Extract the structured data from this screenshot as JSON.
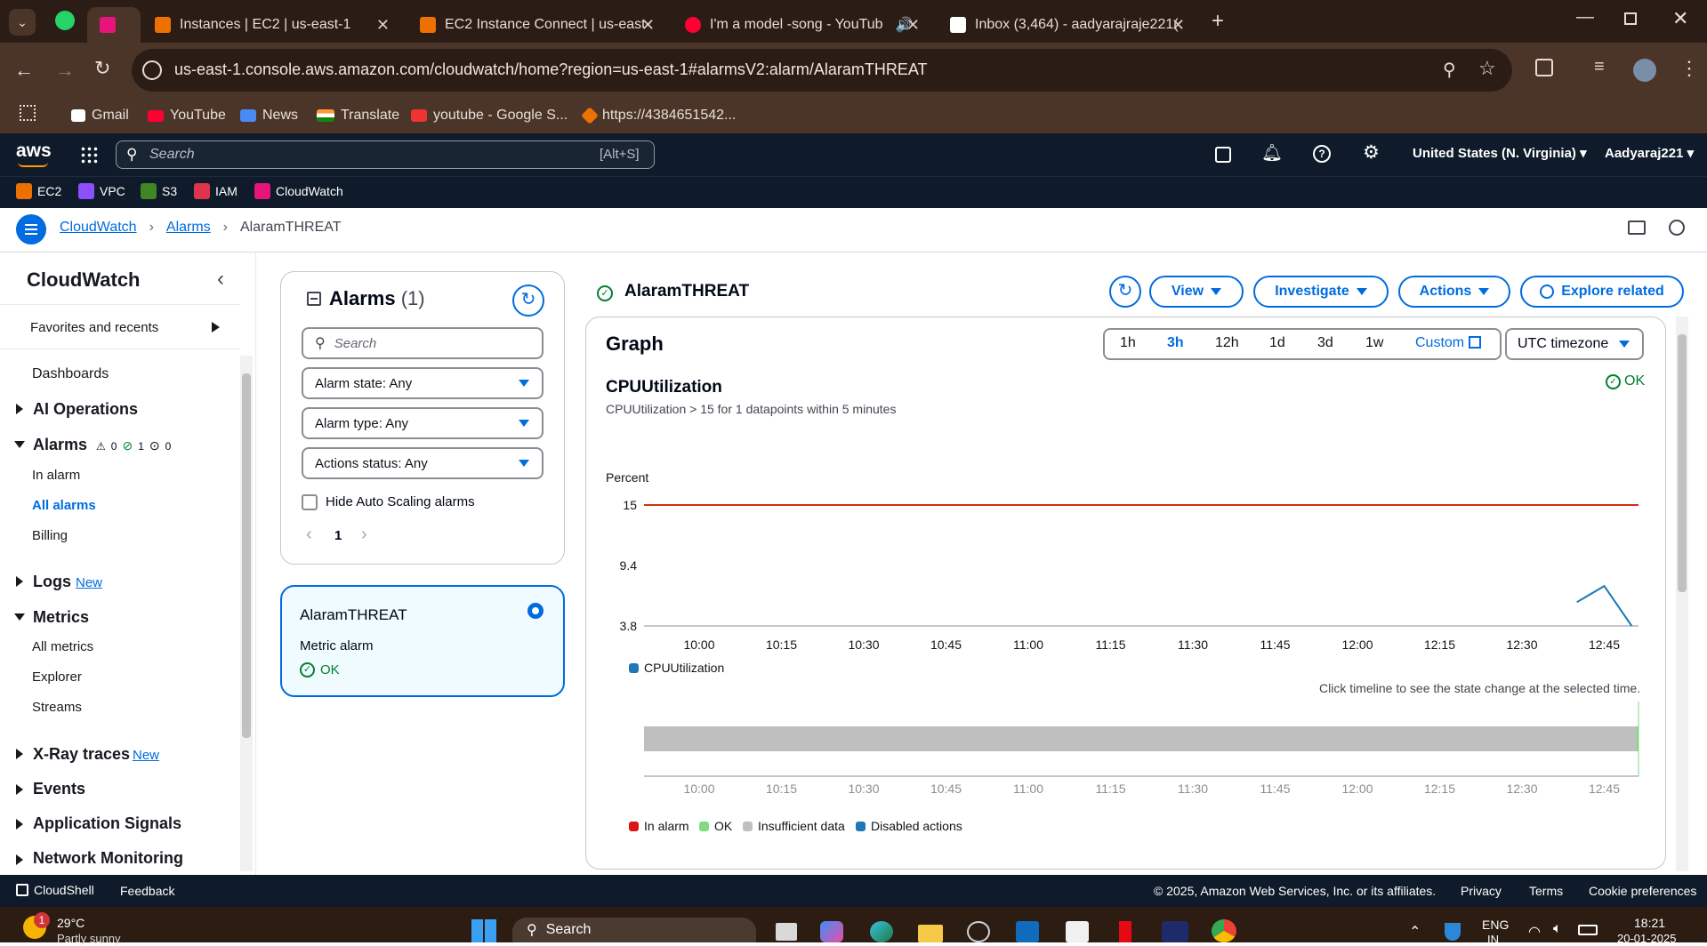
{
  "browser": {
    "tabs": [
      {
        "title": "Instances | EC2 | us-east-1"
      },
      {
        "title": "EC2 Instance Connect | us-east-"
      },
      {
        "title": "I'm a model -song - YouTub"
      },
      {
        "title": "Inbox (3,464) - aadyarajraje221("
      }
    ],
    "url": "us-east-1.console.aws.amazon.com/cloudwatch/home?region=us-east-1#alarmsV2:alarm/AlaramTHREAT",
    "bookmarks": [
      "Gmail",
      "YouTube",
      "News",
      "Translate",
      "youtube - Google S...",
      "https://4384651542..."
    ]
  },
  "aws": {
    "logo": "aws",
    "search_placeholder": "Search",
    "search_shortcut": "[Alt+S]",
    "region": "United States (N. Virginia)",
    "user": "Aadyaraj221",
    "services": [
      "EC2",
      "VPC",
      "S3",
      "IAM",
      "CloudWatch"
    ]
  },
  "breadcrumb": {
    "root": "CloudWatch",
    "section": "Alarms",
    "current": "AlaramTHREAT"
  },
  "sidebar": {
    "title": "CloudWatch",
    "favorites": "Favorites and recents",
    "dashboards": "Dashboards",
    "ai_ops": "AI Operations",
    "alarms": "Alarms",
    "alarm_counts": {
      "in_alarm": "0",
      "ok": "1",
      "insufficient": "0"
    },
    "in_alarm": "In alarm",
    "all_alarms": "All alarms",
    "billing": "Billing",
    "logs": "Logs",
    "new_badge": "New",
    "metrics": "Metrics",
    "all_metrics": "All metrics",
    "explorer": "Explorer",
    "streams": "Streams",
    "xray": "X-Ray traces",
    "events": "Events",
    "app_signals": "Application Signals",
    "network": "Network Monitoring"
  },
  "alarms_panel": {
    "title": "Alarms",
    "count": "(1)",
    "search_placeholder": "Search",
    "state_filter": "Alarm state: Any",
    "type_filter": "Alarm type: Any",
    "actions_filter": "Actions status: Any",
    "hide_autoscaling": "Hide Auto Scaling alarms",
    "page": "1",
    "card": {
      "name": "AlaramTHREAT",
      "type": "Metric alarm",
      "status": "OK"
    }
  },
  "detail": {
    "name": "AlaramTHREAT",
    "buttons": {
      "view": "View",
      "investigate": "Investigate",
      "actions": "Actions",
      "explore": "Explore related"
    },
    "graph_title": "Graph",
    "ranges": [
      "1h",
      "3h",
      "12h",
      "1d",
      "3d",
      "1w"
    ],
    "active_range": "3h",
    "custom": "Custom",
    "timezone": "UTC timezone",
    "metric": "CPUUtilization",
    "condition": "CPUUtilization > 15 for 1 datapoints within 5 minutes",
    "status": "OK",
    "timeline_hint": "Click timeline to see the state change at the selected time.",
    "legend": [
      "In alarm",
      "OK",
      "Insufficient data",
      "Disabled actions"
    ]
  },
  "chart_data": {
    "type": "line",
    "ylabel": "Percent",
    "yticks": [
      "15",
      "9.4",
      "3.8"
    ],
    "ylim": [
      3.8,
      15
    ],
    "categories": [
      "10:00",
      "10:15",
      "10:30",
      "10:45",
      "11:00",
      "11:15",
      "11:30",
      "11:45",
      "12:00",
      "12:15",
      "12:30",
      "12:45"
    ],
    "threshold": 15,
    "series": [
      {
        "name": "CPUUtilization",
        "color": "#1f77b4",
        "x": [
          "12:40",
          "12:45",
          "12:50"
        ],
        "values": [
          6.0,
          7.5,
          3.8
        ]
      }
    ],
    "colors": {
      "threshold": "#d13212",
      "in_alarm": "#d91515",
      "ok": "#7fdb7f",
      "insufficient": "#bfbfbf",
      "disabled": "#1f77b4"
    }
  },
  "footer": {
    "cloudshell": "CloudShell",
    "feedback": "Feedback",
    "copyright": "© 2025, Amazon Web Services, Inc. or its affiliates.",
    "privacy": "Privacy",
    "terms": "Terms",
    "cookies": "Cookie preferences"
  },
  "taskbar": {
    "temp": "29°C",
    "weather": "Partly sunny",
    "search": "Search",
    "lang": "ENG",
    "lang2": "IN",
    "time": "18:21",
    "date": "20-01-2025",
    "badge": "1"
  }
}
